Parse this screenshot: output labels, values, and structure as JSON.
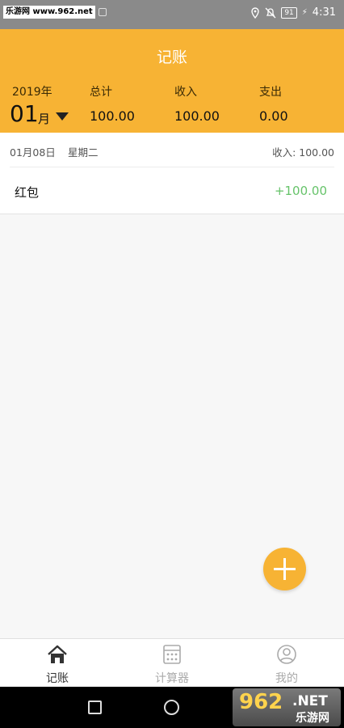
{
  "status_bar": {
    "site_tag": "乐游网 www.962.net",
    "battery": "91",
    "time": "4:31"
  },
  "header": {
    "title": "记账",
    "year": "2019年",
    "month": "01",
    "month_unit": "月",
    "total_label": "总计",
    "total_value": "100.00",
    "income_label": "收入",
    "income_value": "100.00",
    "expense_label": "支出",
    "expense_value": "0.00"
  },
  "records": [
    {
      "date": "01月08日",
      "weekday": "星期二",
      "day_income": "收入: 100.00",
      "items": [
        {
          "name": "红包",
          "amount": "+100.00"
        }
      ]
    }
  ],
  "tabs": [
    {
      "label": "记账",
      "icon": "home-icon",
      "active": true
    },
    {
      "label": "计算器",
      "icon": "calculator-icon",
      "active": false
    },
    {
      "label": "我的",
      "icon": "profile-icon",
      "active": false
    }
  ],
  "watermark": {
    "big": "962",
    "net": ".NET",
    "cn": "乐游网"
  },
  "colors": {
    "accent": "#f7b334",
    "income_green": "#66c36a"
  }
}
